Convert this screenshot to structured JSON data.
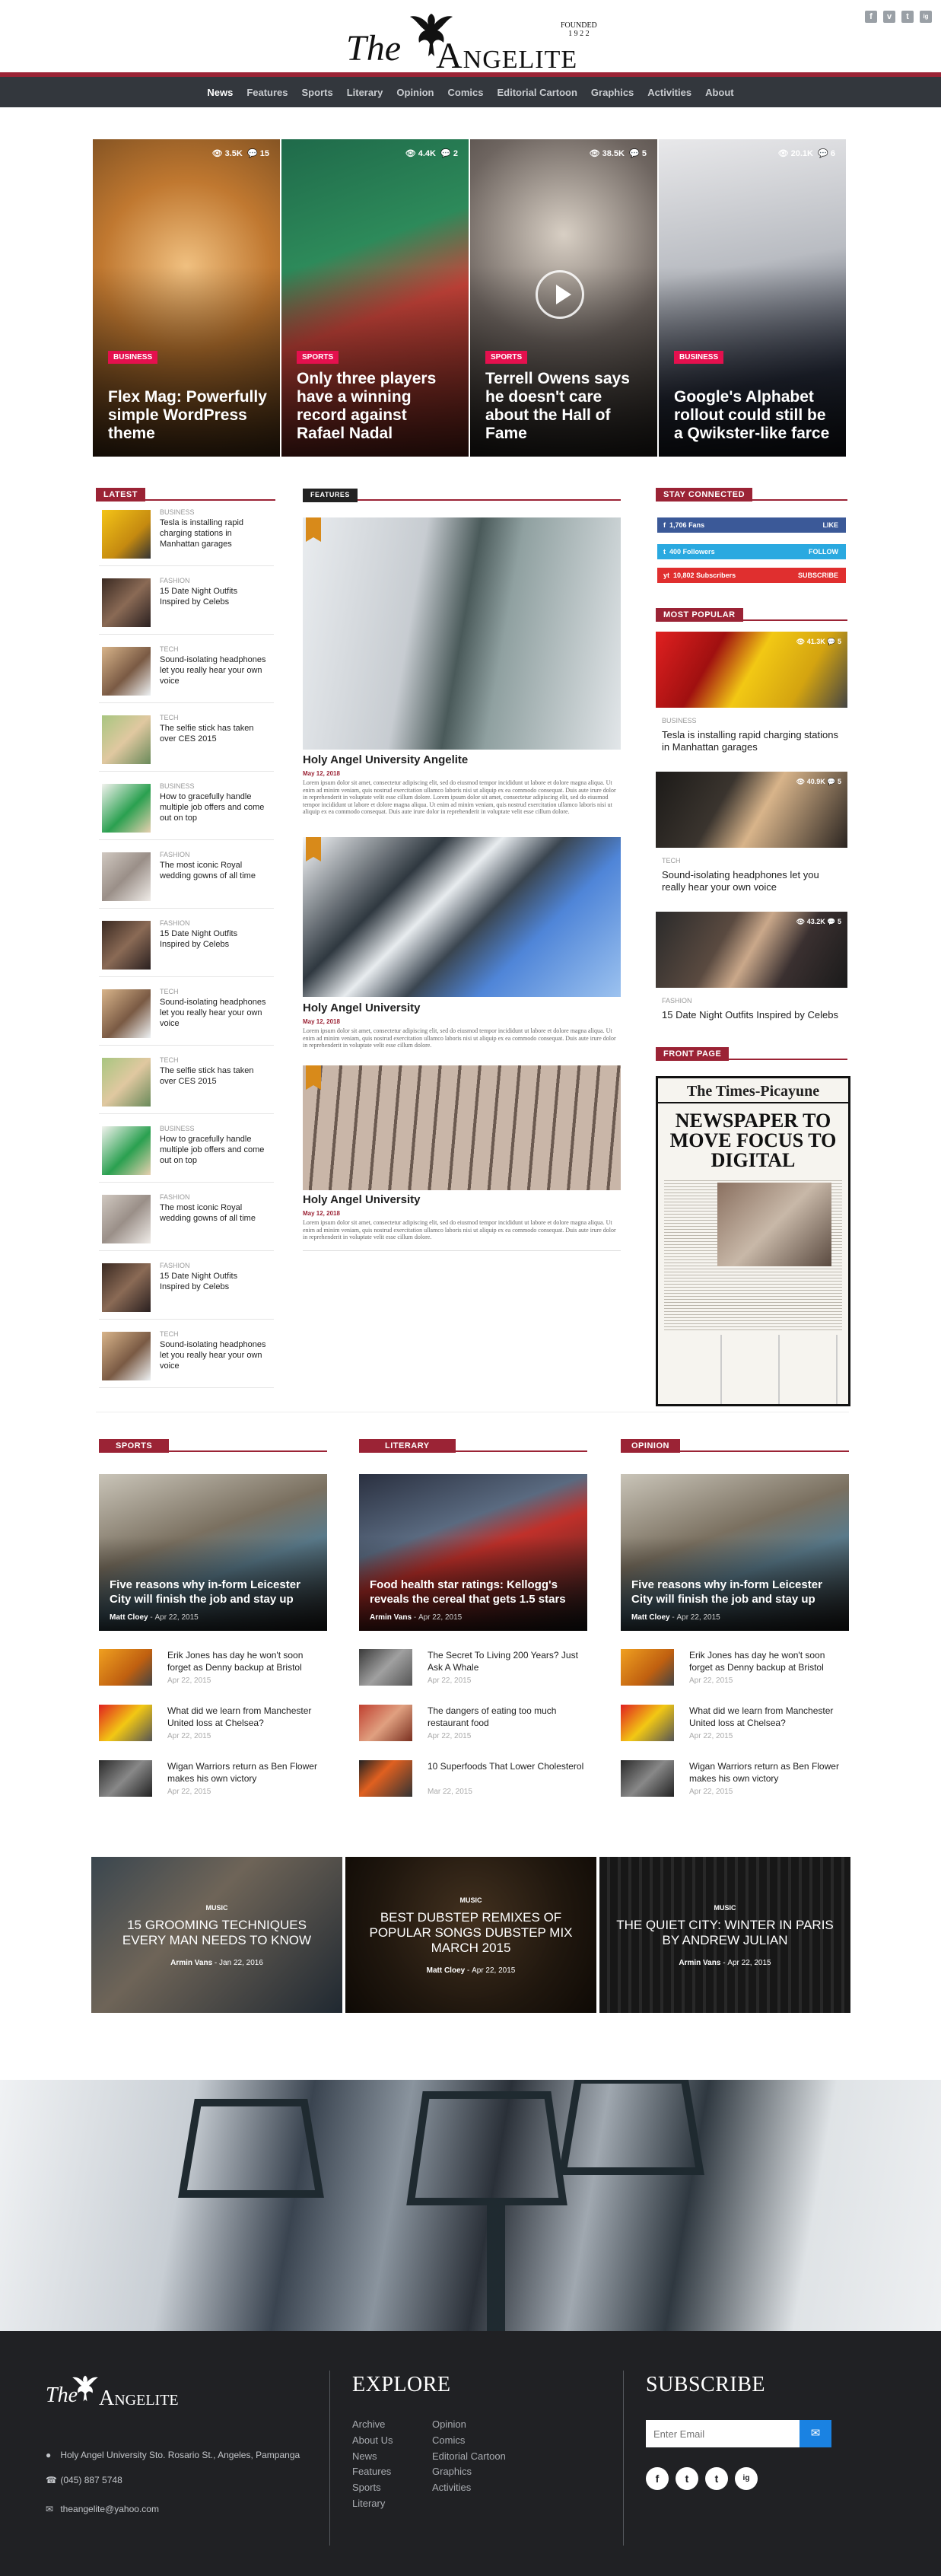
{
  "header": {
    "brand_the": "The",
    "brand_name": "Angelite",
    "founded_label": "FOUNDED",
    "founded_year": "1 9 2 2",
    "social": [
      "f",
      "v",
      "t",
      "ig"
    ]
  },
  "nav": {
    "items": [
      "News",
      "Features",
      "Sports",
      "Literary",
      "Opinion",
      "Comics",
      "Editorial Cartoon",
      "Graphics",
      "Activities",
      "About"
    ],
    "active": "News"
  },
  "hero": [
    {
      "category": "BUSINESS",
      "title": "Flex Mag: Powerfully simple WordPress theme",
      "views": "3.5K",
      "comments": "15",
      "video": false
    },
    {
      "category": "SPORTS",
      "title": "Only three players have a winning record against Rafael Nadal",
      "views": "4.4K",
      "comments": "2",
      "video": false
    },
    {
      "category": "SPORTS",
      "title": "Terrell Owens says he doesn't care about the Hall of Fame",
      "views": "38.5K",
      "comments": "5",
      "video": true
    },
    {
      "category": "BUSINESS",
      "title": "Google's Alphabet rollout could still be a Qwikster-like farce",
      "views": "20.1K",
      "comments": "6",
      "video": false
    }
  ],
  "latest": {
    "heading": "LATEST",
    "items": [
      {
        "category": "BUSINESS",
        "title": "Tesla is installing rapid charging stations in Manhattan garages"
      },
      {
        "category": "FASHION",
        "title": "15 Date Night Outfits Inspired by Celebs"
      },
      {
        "category": "TECH",
        "title": "Sound-isolating headphones let you really hear your own voice"
      },
      {
        "category": "TECH",
        "title": "The selfie stick has taken over CES 2015"
      },
      {
        "category": "BUSINESS",
        "title": "How to gracefully handle multiple job offers and come out on top"
      },
      {
        "category": "FASHION",
        "title": "The most iconic Royal wedding gowns of all time"
      },
      {
        "category": "FASHION",
        "title": "15 Date Night Outfits Inspired by Celebs"
      },
      {
        "category": "TECH",
        "title": "Sound-isolating headphones let you really hear your own voice"
      },
      {
        "category": "TECH",
        "title": "The selfie stick has taken over CES 2015"
      },
      {
        "category": "BUSINESS",
        "title": "How to gracefully handle multiple job offers and come out on top"
      },
      {
        "category": "FASHION",
        "title": "The most iconic Royal wedding gowns of all time"
      },
      {
        "category": "FASHION",
        "title": "15 Date Night Outfits Inspired by Celebs"
      },
      {
        "category": "TECH",
        "title": "Sound-isolating headphones let you really hear your own voice"
      }
    ]
  },
  "features": {
    "heading": "FEATURES",
    "items": [
      {
        "title": "Holy Angel University Angelite",
        "date": "May 12, 2018",
        "excerpt": "Lorem ipsum dolor sit amet, consectetur adipiscing elit, sed do eiusmod tempor incididunt ut labore et dolore magna aliqua. Ut enim ad minim veniam, quis nostrud exercitation ullamco laboris nisi ut aliquip ex ea commodo consequat. Duis aute irure dolor in reprehenderit in voluptate velit esse cillum dolore. Lorem ipsum dolor sit amet, consectetur adipiscing elit, sed do eiusmod tempor incididunt ut labore et dolore magna aliqua. Ut enim ad minim veniam, quis nostrud exercitation ullamco laboris nisi ut aliquip ex ea commodo consequat. Duis aute irure dolor in reprehenderit in voluptate velit esse cillum dolore."
      },
      {
        "title": "Holy Angel University",
        "date": "May 12, 2018",
        "excerpt": "Lorem ipsum dolor sit amet, consectetur adipiscing elit, sed do eiusmod tempor incididunt ut labore et dolore magna aliqua. Ut enim ad minim veniam, quis nostrud exercitation ullamco laboris nisi ut aliquip ex ea commodo consequat. Duis aute irure dolor in reprehenderit in voluptate velit esse cillum dolore."
      },
      {
        "title": "Holy Angel University",
        "date": "May 12, 2018",
        "excerpt": "Lorem ipsum dolor sit amet, consectetur adipiscing elit, sed do eiusmod tempor incididunt ut labore et dolore magna aliqua. Ut enim ad minim veniam, quis nostrud exercitation ullamco laboris nisi ut aliquip ex ea commodo consequat. Duis aute irure dolor in reprehenderit in voluptate velit esse cillum dolore."
      }
    ]
  },
  "stay_connected": {
    "heading": "STAY CONNECTED",
    "buttons": [
      {
        "icon": "f",
        "count": "1,706",
        "label": "Fans",
        "action": "LIKE",
        "color": "#3b5998"
      },
      {
        "icon": "t",
        "count": "400",
        "label": "Followers",
        "action": "FOLLOW",
        "color": "#2aa9e0"
      },
      {
        "icon": "yt",
        "count": "10,802",
        "label": "Subscribers",
        "action": "SUBSCRIBE",
        "color": "#e02f2f"
      }
    ]
  },
  "most_popular": {
    "heading": "MOST POPULAR",
    "items": [
      {
        "category": "BUSINESS",
        "title": "Tesla is installing rapid charging stations in Manhattan garages",
        "views": "41.3K",
        "comments": "5"
      },
      {
        "category": "TECH",
        "title": "Sound-isolating headphones let you really hear your own voice",
        "views": "40.9K",
        "comments": "5"
      },
      {
        "category": "FASHION",
        "title": "15 Date Night Outfits Inspired by Celebs",
        "views": "43.2K",
        "comments": "5"
      }
    ]
  },
  "front_page": {
    "heading": "FRONT PAGE",
    "masthead": "The Times-Picayune",
    "headline": "NEWSPAPER TO MOVE FOCUS TO DIGITAL"
  },
  "sections": [
    {
      "heading": "SPORTS",
      "featured": {
        "title": "Five reasons why in-form Leicester City will finish the job and stay up",
        "author": "Matt Cloey",
        "date": "Apr 22, 2015"
      },
      "items": [
        {
          "title": "Erik Jones has day he won't soon forget as Denny backup at Bristol",
          "date": "Apr 22, 2015"
        },
        {
          "title": "What did we learn from Manchester United loss at Chelsea?",
          "date": "Apr 22, 2015"
        },
        {
          "title": "Wigan Warriors return as Ben Flower makes his own victory",
          "date": "Apr 22, 2015"
        }
      ]
    },
    {
      "heading": "LITERARY",
      "featured": {
        "title": "Food health star ratings: Kellogg's reveals the cereal that gets 1.5 stars",
        "author": "Armin Vans",
        "date": "Apr 22, 2015"
      },
      "items": [
        {
          "title": "The Secret To Living 200 Years? Just Ask A Whale",
          "date": "Apr 22, 2015"
        },
        {
          "title": "The dangers of eating too much restaurant food",
          "date": "Apr 22, 2015"
        },
        {
          "title": "10 Superfoods That Lower Cholesterol",
          "date": "Mar 22, 2015"
        }
      ]
    },
    {
      "heading": "OPINION",
      "featured": {
        "title": "Five reasons why in-form Leicester City will finish the job and stay up",
        "author": "Matt Cloey",
        "date": "Apr 22, 2015"
      },
      "items": [
        {
          "title": "Erik Jones has day he won't soon forget as Denny backup at Bristol",
          "date": "Apr 22, 2015"
        },
        {
          "title": "What did we learn from Manchester United loss at Chelsea?",
          "date": "Apr 22, 2015"
        },
        {
          "title": "Wigan Warriors return as Ben Flower makes his own victory",
          "date": "Apr 22, 2015"
        }
      ]
    }
  ],
  "music": [
    {
      "category": "MUSIC",
      "title": "15 GROOMING TECHNIQUES EVERY MAN NEEDS TO KNOW",
      "author": "Armin Vans",
      "date": "Jan 22, 2016"
    },
    {
      "category": "MUSIC",
      "title": "BEST DUBSTEP REMIXES OF POPULAR SONGS DUBSTEP MIX MARCH 2015",
      "author": "Matt Cloey",
      "date": "Apr 22, 2015"
    },
    {
      "category": "MUSIC",
      "title": "THE QUIET CITY: WINTER IN PARIS BY ANDREW JULIAN",
      "author": "Armin Vans",
      "date": "Apr 22, 2015"
    }
  ],
  "footer": {
    "brand_the": "The",
    "brand_name": "Angelite",
    "address": "Holy Angel University Sto. Rosario St., Angeles, Pampanga",
    "phone": "(045) 887 5748",
    "email": "theangelite@yahoo.com",
    "explore_heading": "EXPLORE",
    "explore_col1": [
      "Archive",
      "About Us",
      "News",
      "Features",
      "Sports",
      "Literary"
    ],
    "explore_col2": [
      "Opinion",
      "Comics",
      "Editorial Cartoon",
      "Graphics",
      "Activities"
    ],
    "subscribe_heading": "SUBSCRIBE",
    "email_placeholder": "Enter Email",
    "social": [
      "f",
      "t",
      "t",
      "ig"
    ]
  },
  "sep": "-"
}
